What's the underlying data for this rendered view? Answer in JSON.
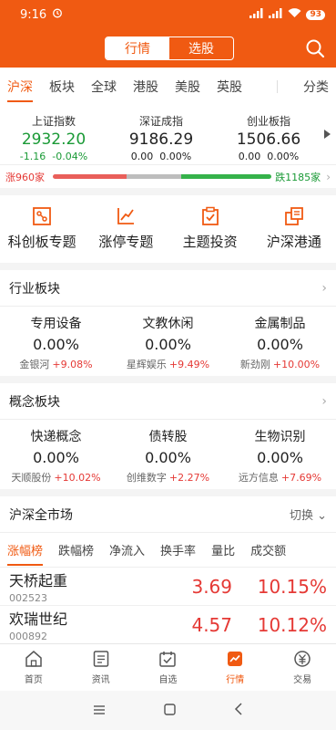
{
  "status": {
    "time": "9:16",
    "battery": "93"
  },
  "header": {
    "seg_market": "行情",
    "seg_pick": "选股"
  },
  "tabs": [
    "沪深",
    "板块",
    "全球",
    "港股",
    "美股",
    "英股"
  ],
  "tab_more": "分类",
  "indices": [
    {
      "name": "上证指数",
      "value": "2932.20",
      "change": "-1.16",
      "pct": "-0.04%"
    },
    {
      "name": "深证成指",
      "value": "9186.29",
      "change": "0.00",
      "pct": "0.00%"
    },
    {
      "name": "创业板指",
      "value": "1506.66",
      "change": "0.00",
      "pct": "0.00%"
    }
  ],
  "breadth": {
    "up_label": "涨960家",
    "down_label": "跌1185家",
    "up_count": 960,
    "down_count": 1185
  },
  "quick": [
    {
      "label": "科创板专题",
      "icon": "chip-icon"
    },
    {
      "label": "涨停专题",
      "icon": "rising-chart-icon"
    },
    {
      "label": "主题投资",
      "icon": "clipboard-check-icon"
    },
    {
      "label": "沪深港通",
      "icon": "connect-icon"
    }
  ],
  "industry": {
    "title": "行业板块",
    "items": [
      {
        "name": "专用设备",
        "pct": "0.00%",
        "lead": "金银河",
        "lead_pct": "+9.08%"
      },
      {
        "name": "文教休闲",
        "pct": "0.00%",
        "lead": "星辉娱乐",
        "lead_pct": "+9.49%"
      },
      {
        "name": "金属制品",
        "pct": "0.00%",
        "lead": "新劲刚",
        "lead_pct": "+10.00%"
      }
    ]
  },
  "concept": {
    "title": "概念板块",
    "items": [
      {
        "name": "快递概念",
        "pct": "0.00%",
        "lead": "天顺股份",
        "lead_pct": "+10.02%"
      },
      {
        "name": "债转股",
        "pct": "0.00%",
        "lead": "创维数字",
        "lead_pct": "+2.27%"
      },
      {
        "name": "生物识别",
        "pct": "0.00%",
        "lead": "远方信息",
        "lead_pct": "+7.69%"
      }
    ]
  },
  "market": {
    "title": "沪深全市场",
    "switch": "切换",
    "rank_tabs": [
      "涨幅榜",
      "跌幅榜",
      "净流入",
      "换手率",
      "量比",
      "成交额"
    ],
    "rows": [
      {
        "name": "天桥起重",
        "code": "002523",
        "price": "3.69",
        "gain": "10.15%"
      },
      {
        "name": "欢瑞世纪",
        "code": "000892",
        "price": "4.57",
        "gain": "10.12%"
      }
    ]
  },
  "nav": [
    {
      "label": "首页",
      "icon": "home-icon"
    },
    {
      "label": "资讯",
      "icon": "news-icon"
    },
    {
      "label": "自选",
      "icon": "watchlist-icon"
    },
    {
      "label": "行情",
      "icon": "market-icon"
    },
    {
      "label": "交易",
      "icon": "trade-icon"
    }
  ],
  "colors": {
    "brand": "#f05a12",
    "up": "#e53935",
    "down": "#1a9a36"
  }
}
